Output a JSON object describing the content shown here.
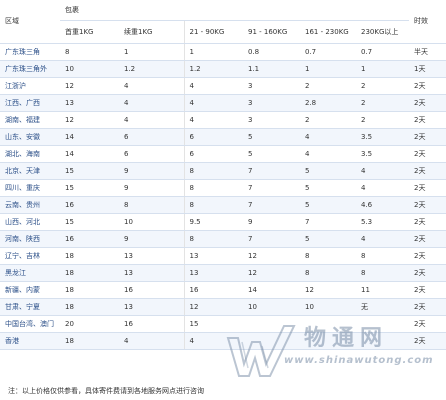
{
  "table": {
    "header": {
      "region": "区域",
      "parcel_group": "包裹",
      "timeliness": "时效",
      "first_kg": "首重1KG",
      "additional_kg": "续重1KG",
      "bracket_21_90": "21 - 90KG",
      "bracket_91_160": "91 - 160KG",
      "bracket_161_230": "161 - 230KG",
      "bracket_230_plus": "230KG以上"
    },
    "rows": [
      {
        "zone": "广东珠三角",
        "first": "8",
        "extra": "1",
        "b21_90": "1",
        "b91_160": "0.8",
        "b161_230": "0.7",
        "b230": "0.7",
        "time": "半天"
      },
      {
        "zone": "广东珠三角外",
        "first": "10",
        "extra": "1.2",
        "b21_90": "1.2",
        "b91_160": "1.1",
        "b161_230": "1",
        "b230": "1",
        "time": "1天"
      },
      {
        "zone": "江浙沪",
        "first": "12",
        "extra": "4",
        "b21_90": "4",
        "b91_160": "3",
        "b161_230": "2",
        "b230": "2",
        "time": "2天"
      },
      {
        "zone": "江西、广西",
        "first": "13",
        "extra": "4",
        "b21_90": "4",
        "b91_160": "3",
        "b161_230": "2.8",
        "b230": "2",
        "time": "2天"
      },
      {
        "zone": "湖南、福建",
        "first": "12",
        "extra": "4",
        "b21_90": "4",
        "b91_160": "3",
        "b161_230": "2",
        "b230": "2",
        "time": "2天"
      },
      {
        "zone": "山东、安徽",
        "first": "14",
        "extra": "6",
        "b21_90": "6",
        "b91_160": "5",
        "b161_230": "4",
        "b230": "3.5",
        "time": "2天"
      },
      {
        "zone": "湖北、海南",
        "first": "14",
        "extra": "6",
        "b21_90": "6",
        "b91_160": "5",
        "b161_230": "4",
        "b230": "3.5",
        "time": "2天"
      },
      {
        "zone": "北京、天津",
        "first": "15",
        "extra": "9",
        "b21_90": "8",
        "b91_160": "7",
        "b161_230": "5",
        "b230": "4",
        "time": "2天"
      },
      {
        "zone": "四川、重庆",
        "first": "15",
        "extra": "9",
        "b21_90": "8",
        "b91_160": "7",
        "b161_230": "5",
        "b230": "4",
        "time": "2天"
      },
      {
        "zone": "云南、贵州",
        "first": "16",
        "extra": "8",
        "b21_90": "8",
        "b91_160": "7",
        "b161_230": "5",
        "b230": "4.6",
        "time": "2天"
      },
      {
        "zone": "山西、河北",
        "first": "15",
        "extra": "10",
        "b21_90": "9.5",
        "b91_160": "9",
        "b161_230": "7",
        "b230": "5.3",
        "time": "2天"
      },
      {
        "zone": "河南、陕西",
        "first": "16",
        "extra": "9",
        "b21_90": "8",
        "b91_160": "7",
        "b161_230": "5",
        "b230": "4",
        "time": "2天"
      },
      {
        "zone": "辽宁、吉林",
        "first": "18",
        "extra": "13",
        "b21_90": "13",
        "b91_160": "12",
        "b161_230": "8",
        "b230": "8",
        "time": "2天"
      },
      {
        "zone": "黑龙江",
        "first": "18",
        "extra": "13",
        "b21_90": "13",
        "b91_160": "12",
        "b161_230": "8",
        "b230": "8",
        "time": "2天"
      },
      {
        "zone": "新疆、内蒙",
        "first": "18",
        "extra": "16",
        "b21_90": "16",
        "b91_160": "14",
        "b161_230": "12",
        "b230": "11",
        "time": "2天"
      },
      {
        "zone": "甘肃、宁夏",
        "first": "18",
        "extra": "13",
        "b21_90": "12",
        "b91_160": "10",
        "b161_230": "10",
        "b230": "无",
        "time": "2天"
      },
      {
        "zone": "中国台湾、澳门",
        "first": "20",
        "extra": "16",
        "b21_90": "15",
        "b91_160": "",
        "b161_230": "",
        "b230": "",
        "time": "2天"
      },
      {
        "zone": "香港",
        "first": "18",
        "extra": "4",
        "b21_90": "4",
        "b91_160": "",
        "b161_230": "",
        "b230": "",
        "time": "2天"
      }
    ]
  },
  "note": "注：以上价格仅供参看，具体寄件费请到各地服务网点进行咨询",
  "watermark": {
    "name": "物通网",
    "site": "www.shinawutong.com"
  }
}
